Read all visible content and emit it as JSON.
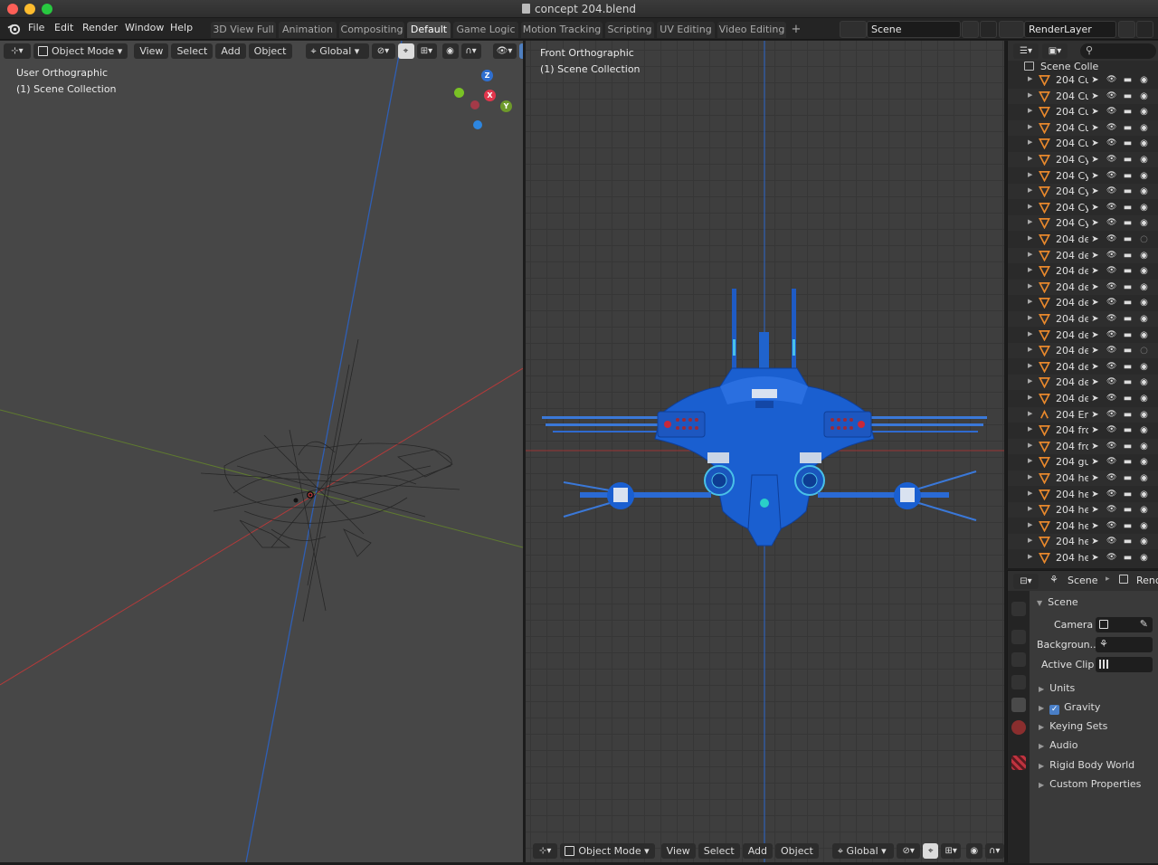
{
  "window": {
    "title": "concept 204.blend"
  },
  "menu": [
    "File",
    "Edit",
    "Render",
    "Window",
    "Help"
  ],
  "workspaces": [
    {
      "label": "3D View Full",
      "active": false
    },
    {
      "label": "Animation",
      "active": false
    },
    {
      "label": "Compositing",
      "active": false
    },
    {
      "label": "Default",
      "active": true
    },
    {
      "label": "Game Logic",
      "active": false
    },
    {
      "label": "Motion Tracking",
      "active": false
    },
    {
      "label": "Scripting",
      "active": false
    },
    {
      "label": "UV Editing",
      "active": false
    },
    {
      "label": "Video Editing",
      "active": false
    }
  ],
  "scene_selector": {
    "value": "Scene"
  },
  "layer_selector": {
    "value": "RenderLayer"
  },
  "viewport_left": {
    "mode": "Object Mode",
    "menus": [
      "View",
      "Select",
      "Add",
      "Object"
    ],
    "orientation": "Global",
    "view_name": "User Orthographic",
    "collection": "(1) Scene Collection",
    "gizmo": {
      "z": "Z",
      "x": "X",
      "y": "Y"
    }
  },
  "viewport_right": {
    "mode": "Object Mode",
    "menus": [
      "View",
      "Select",
      "Add",
      "Object"
    ],
    "orientation": "Global",
    "view_name": "Front Orthographic",
    "collection": "(1) Scene Collection"
  },
  "outliner": {
    "root": "Scene Colle",
    "items": [
      {
        "name": "204 Cu",
        "type": "mesh",
        "render": true
      },
      {
        "name": "204 Cu",
        "type": "mesh",
        "render": true
      },
      {
        "name": "204 Cu",
        "type": "mesh",
        "render": true
      },
      {
        "name": "204 Cu",
        "type": "mesh",
        "render": true
      },
      {
        "name": "204 Cu",
        "type": "mesh",
        "render": true
      },
      {
        "name": "204 Cy",
        "type": "mesh",
        "render": true
      },
      {
        "name": "204 Cy",
        "type": "mesh",
        "render": true
      },
      {
        "name": "204 Cy",
        "type": "mesh",
        "render": true
      },
      {
        "name": "204 Cy",
        "type": "mesh",
        "render": true
      },
      {
        "name": "204 Cy",
        "type": "mesh",
        "render": true
      },
      {
        "name": "204 de",
        "type": "mesh",
        "render": false
      },
      {
        "name": "204 de",
        "type": "mesh",
        "render": true
      },
      {
        "name": "204 de",
        "type": "mesh",
        "render": true
      },
      {
        "name": "204 de",
        "type": "mesh",
        "render": true
      },
      {
        "name": "204 de",
        "type": "mesh",
        "render": true
      },
      {
        "name": "204 de",
        "type": "mesh",
        "render": true
      },
      {
        "name": "204 de",
        "type": "mesh",
        "render": true
      },
      {
        "name": "204 de",
        "type": "mesh",
        "render": false
      },
      {
        "name": "204 de",
        "type": "mesh",
        "render": true
      },
      {
        "name": "204 de",
        "type": "mesh",
        "render": true
      },
      {
        "name": "204 de",
        "type": "mesh",
        "render": true
      },
      {
        "name": "204 Em",
        "type": "empty",
        "render": true
      },
      {
        "name": "204 fro",
        "type": "mesh",
        "render": true
      },
      {
        "name": "204 fro",
        "type": "mesh",
        "render": true
      },
      {
        "name": "204 gu",
        "type": "mesh",
        "render": true
      },
      {
        "name": "204 he",
        "type": "mesh",
        "render": true
      },
      {
        "name": "204 he",
        "type": "mesh",
        "render": true
      },
      {
        "name": "204 he",
        "type": "mesh",
        "render": true
      },
      {
        "name": "204 he",
        "type": "mesh",
        "render": true
      },
      {
        "name": "204 he",
        "type": "mesh",
        "render": true
      },
      {
        "name": "204 he",
        "type": "mesh",
        "render": true
      }
    ]
  },
  "properties": {
    "breadcrumb_scene": "Scene",
    "breadcrumb_next": "Renc",
    "panel_title": "Scene",
    "camera_label": "Camera",
    "background_label": "Backgroun..",
    "active_clip_label": "Active Clip",
    "subpanels": [
      "Units",
      "Gravity",
      "Keying Sets",
      "Audio",
      "Rigid Body World",
      "Custom Properties"
    ],
    "gravity_checked": true
  },
  "colors": {
    "accent_blue": "#4f7fc0",
    "ship_blue": "#1a5fd0",
    "mesh_orange": "#e8882c",
    "axis_red": "#c23a3a",
    "axis_green": "#6e8a2c",
    "axis_blue": "#2f5fb5"
  }
}
